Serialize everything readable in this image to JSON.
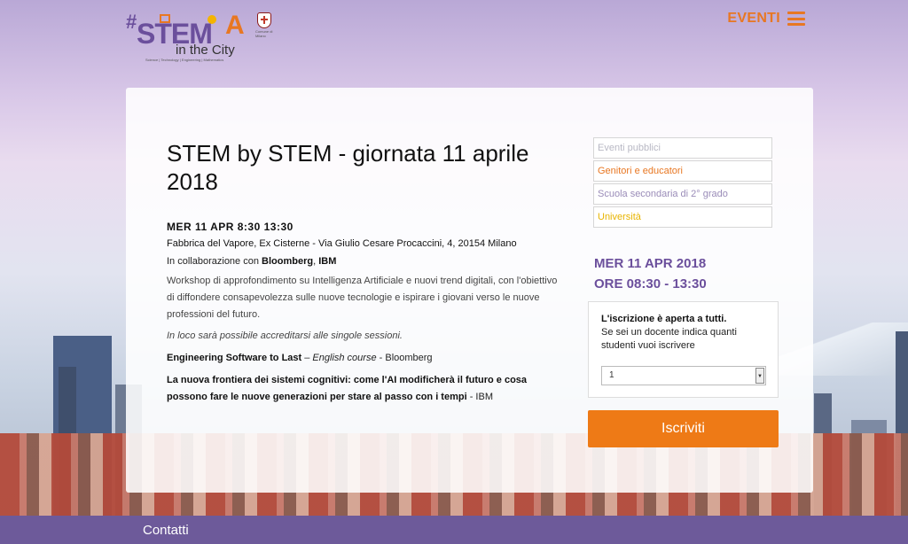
{
  "header": {
    "logo": {
      "hash": "#",
      "stem": "STEM",
      "a": "A",
      "tagline": "in the City",
      "subtitle": "Science | Technology | Engineering | Mathematics",
      "milano_label": "Comune di Milano"
    },
    "nav": {
      "eventi_label": "EVENTI"
    }
  },
  "event": {
    "title": "STEM by STEM - giornata 11 aprile 2018",
    "datetime": "MER 11 APR  8:30 13:30",
    "address": "Fabbrica del Vapore, Ex Cisterne - Via Giulio Cesare Procaccini, 4, 20154 Milano",
    "collab_prefix": "In collaborazione con ",
    "collab_partner1": "Bloomberg",
    "collab_sep": ", ",
    "collab_partner2": "IBM",
    "description": "Workshop di approfondimento su Intelligenza Artificiale e nuovi trend digitali, con l'obiettivo di diffondere consapevolezza sulle nuove tecnologie e ispirare i giovani verso le nuove professioni del futuro.",
    "note": "In loco sarà possibile accreditarsi alle singole sessioni.",
    "session1_title": "Engineering Software to Last",
    "session1_dash": " – ",
    "session1_lang": "English course",
    "session1_org": " - Bloomberg",
    "session2_title": "La nuova frontiera dei sistemi cognitivi: come l'AI modificherà il futuro e cosa possono fare le nuove generazioni per stare al passo con i tempi",
    "session2_org": " - IBM"
  },
  "filters": [
    {
      "label": "Eventi pubblici",
      "color": "#b8b8c4"
    },
    {
      "label": "Genitori e educatori",
      "color": "#e87722"
    },
    {
      "label": "Scuola secondaria di 2° grado",
      "color": "#9a8cb8"
    },
    {
      "label": "Università",
      "color": "#e8b400"
    }
  ],
  "sidebar": {
    "date_line": "MER 11 APR 2018",
    "time_line": "ORE 08:30 - 13:30"
  },
  "registration": {
    "title": "L'iscrizione è aperta a tutti.",
    "text": "Se sei un docente indica quanti studenti vuoi iscrivere",
    "quantity_value": "1",
    "button_label": "Iscriviti"
  },
  "footer": {
    "contatti_label": "Contatti"
  },
  "colors": {
    "accent": "#ee7a16",
    "brand": "#6b4f9c",
    "footer_bg": "#6d5a9a"
  }
}
